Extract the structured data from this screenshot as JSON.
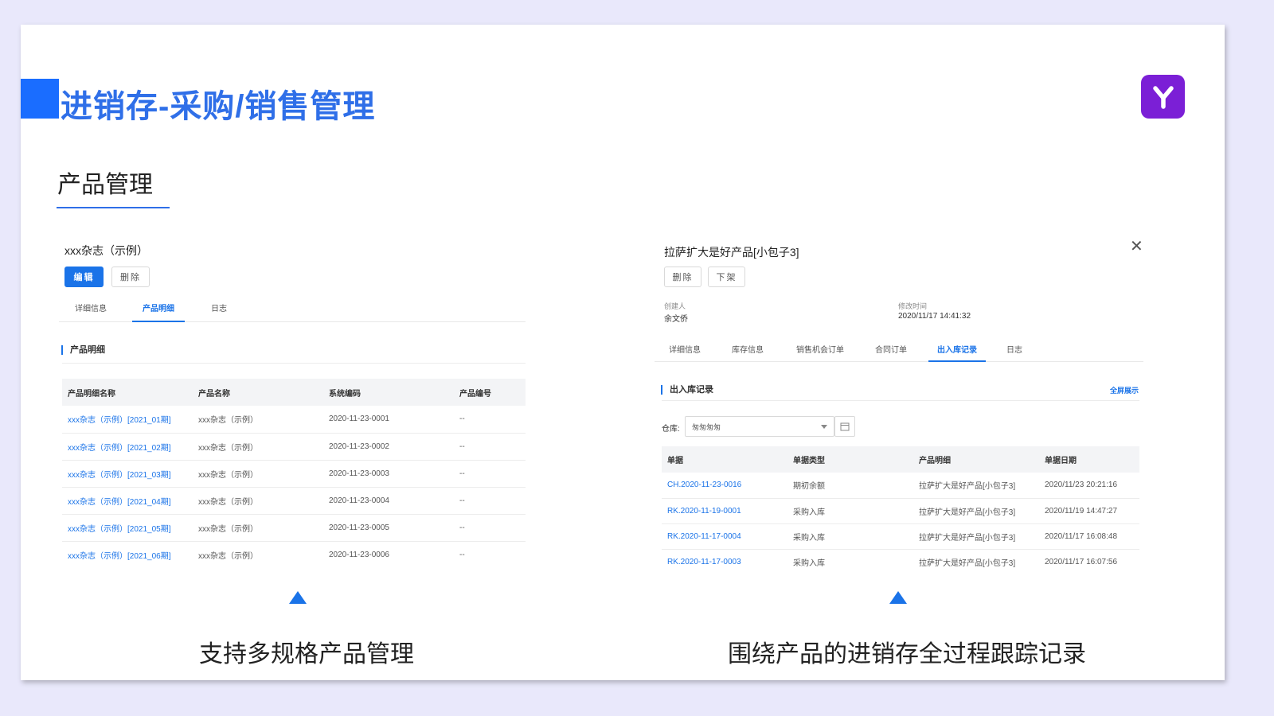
{
  "slide": {
    "title": "进销存-采购/销售管理",
    "section_heading": "产品管理",
    "logo_letter": "Y",
    "brand_color": "#7b1fd6",
    "accent_color": "#1a6dff"
  },
  "left": {
    "record_title": "xxx杂志（示例）",
    "edit_label": "编辑",
    "delete_label": "删除",
    "tabs": [
      "详细信息",
      "产品明细",
      "日志"
    ],
    "active_tab": "产品明细",
    "sub_heading": "产品明细",
    "table": {
      "headers": [
        "产品明细名称",
        "产品名称",
        "系统编码",
        "产品编号"
      ],
      "rows": [
        [
          "xxx杂志（示例）[2021_01期]",
          "xxx杂志（示例）",
          "2020-11-23-0001",
          "--"
        ],
        [
          "xxx杂志（示例）[2021_02期]",
          "xxx杂志（示例）",
          "2020-11-23-0002",
          "--"
        ],
        [
          "xxx杂志（示例）[2021_03期]",
          "xxx杂志（示例）",
          "2020-11-23-0003",
          "--"
        ],
        [
          "xxx杂志（示例）[2021_04期]",
          "xxx杂志（示例）",
          "2020-11-23-0004",
          "--"
        ],
        [
          "xxx杂志（示例）[2021_05期]",
          "xxx杂志（示例）",
          "2020-11-23-0005",
          "--"
        ],
        [
          "xxx杂志（示例）[2021_06期]",
          "xxx杂志（示例）",
          "2020-11-23-0006",
          "--"
        ]
      ]
    },
    "caption": "支持多规格产品管理"
  },
  "right": {
    "record_title": "拉萨扩大是好产品[小包子3]",
    "delete_label": "删除",
    "offshelf_label": "下架",
    "creator_label": "创建人",
    "creator_value": "余文侨",
    "modified_label": "修改时间",
    "modified_value": "2020/11/17 14:41:32",
    "tabs": [
      "详细信息",
      "库存信息",
      "销售机会订单",
      "合同订单",
      "出入库记录",
      "日志"
    ],
    "active_tab": "出入库记录",
    "sub_heading": "出入库记录",
    "fullscreen_label": "全屏展示",
    "warehouse_label": "仓库:",
    "warehouse_value": "匆匆匆匆",
    "table": {
      "headers": [
        "单据",
        "单据类型",
        "产品明细",
        "单据日期"
      ],
      "rows": [
        [
          "CH.2020-11-23-0016",
          "期初余额",
          "拉萨扩大是好产品[小包子3]",
          "2020/11/23 20:21:16"
        ],
        [
          "RK.2020-11-19-0001",
          "采购入库",
          "拉萨扩大是好产品[小包子3]",
          "2020/11/19 14:47:27"
        ],
        [
          "RK.2020-11-17-0004",
          "采购入库",
          "拉萨扩大是好产品[小包子3]",
          "2020/11/17 16:08:48"
        ],
        [
          "RK.2020-11-17-0003",
          "采购入库",
          "拉萨扩大是好产品[小包子3]",
          "2020/11/17 16:07:56"
        ]
      ]
    },
    "caption": "围绕产品的进销存全过程跟踪记录"
  }
}
